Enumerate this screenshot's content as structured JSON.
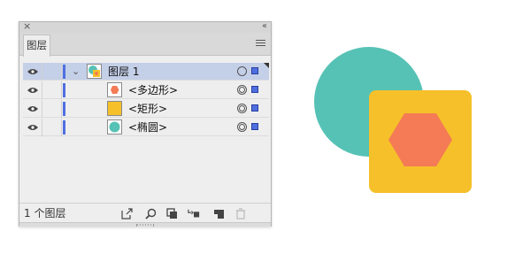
{
  "panel": {
    "tab_label": "图层",
    "layer_count": "1 个图层"
  },
  "layers": [
    {
      "name": "图层 1",
      "selected": true,
      "thumb": "layer-composite-thumbnail"
    },
    {
      "name": "<多边形>",
      "selected": false,
      "thumb": "polygon-thumbnail"
    },
    {
      "name": "<矩形>",
      "selected": false,
      "thumb": "rectangle-thumbnail"
    },
    {
      "name": "<椭圆>",
      "selected": false,
      "thumb": "ellipse-thumbnail"
    }
  ],
  "colors": {
    "circle": "#56c2b5",
    "square": "#f6c02a",
    "hexagon": "#f47b55",
    "layer_color": "#4f6fe0",
    "selected_row": "#c4cfe8"
  }
}
